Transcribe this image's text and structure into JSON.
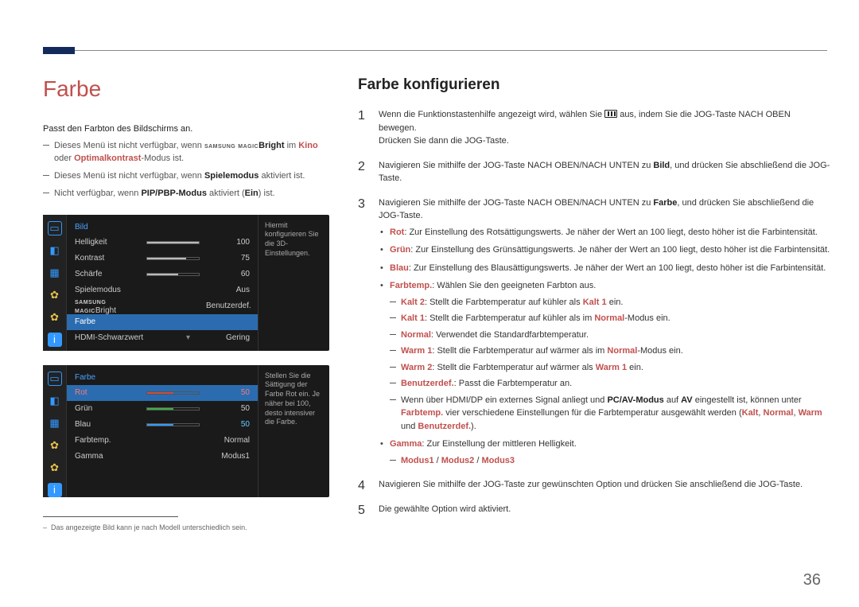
{
  "page_number": "36",
  "left": {
    "heading": "Farbe",
    "intro": "Passt den Farbton des Bildschirms an.",
    "note1_pre": "Dieses Menü ist nicht verfügbar, wenn ",
    "note1_magic_brand": "SAMSUNG",
    "note1_magic": "MAGIC",
    "note1_bright": "Bright",
    "note1_mid": " im ",
    "note1_kino": "Kino",
    "note1_or": " oder ",
    "note1_opt": "Optimalkontrast",
    "note1_suf": "-Modus ist.",
    "note2_pre": "Dieses Menü ist nicht verfügbar, wenn ",
    "note2_spiel": "Spielemodus",
    "note2_suf": " aktiviert ist.",
    "note3_pre": "Nicht verfügbar, wenn ",
    "note3_pip": "PIP/PBP-Modus",
    "note3_mid": " aktiviert (",
    "note3_ein": "Ein",
    "note3_suf": ") ist.",
    "footnote": "Das angezeigte Bild kann je nach Modell unterschiedlich sein."
  },
  "osd1": {
    "title": "Bild",
    "rows": {
      "helligkeit": {
        "label": "Helligkeit",
        "value": "100",
        "pct": 100
      },
      "kontrast": {
        "label": "Kontrast",
        "value": "75",
        "pct": 75
      },
      "schaerfe": {
        "label": "Schärfe",
        "value": "60",
        "pct": 60
      },
      "spielemodus": {
        "label": "Spielemodus",
        "value": "Aus"
      },
      "magicbright": {
        "label_brand": "SAMSUNG",
        "label_magic": "MAGIC",
        "label_suffix": "Bright",
        "value": "Benutzerdef."
      },
      "farbe": {
        "label": "Farbe"
      },
      "hdmi": {
        "label": "HDMI-Schwarzwert",
        "value": "Gering"
      }
    },
    "hint": "Hiermit konfigurieren Sie die 3D-Einstellungen."
  },
  "osd2": {
    "title": "Farbe",
    "rows": {
      "rot": {
        "label": "Rot",
        "value": "50",
        "pct": 50
      },
      "gruen": {
        "label": "Grün",
        "value": "50",
        "pct": 50
      },
      "blau": {
        "label": "Blau",
        "value": "50",
        "pct": 50
      },
      "farbtemp": {
        "label": "Farbtemp.",
        "value": "Normal"
      },
      "gamma": {
        "label": "Gamma",
        "value": "Modus1"
      }
    },
    "hint": "Stellen Sie die Sättigung der Farbe Rot ein. Je näher bei 100, desto intensiver die Farbe."
  },
  "right": {
    "heading": "Farbe konfigurieren",
    "step1a": "Wenn die Funktionstastenhilfe angezeigt wird, wählen Sie ",
    "step1b": " aus, indem Sie die JOG-Taste NACH OBEN bewegen.",
    "step1c": "Drücken Sie dann die JOG-Taste.",
    "step2a": "Navigieren Sie mithilfe der JOG-Taste NACH OBEN/NACH UNTEN zu ",
    "step2_bild": "Bild",
    "step2b": ", und drücken Sie abschließend die JOG-Taste.",
    "step3_farbe": "Farbe",
    "rot_lbl": "Rot",
    "rot_txt": ": Zur Einstellung des Rotsättigungswerts. Je näher der Wert an 100 liegt, desto höher ist die Farbintensität.",
    "gruen_lbl": "Grün",
    "gruen_txt": ": Zur Einstellung des Grünsättigungswerts. Je näher der Wert an 100 liegt, desto höher ist die Farbintensität.",
    "blau_lbl": "Blau",
    "blau_txt": ": Zur Einstellung des Blausättigungswerts. Je näher der Wert an 100 liegt, desto höher ist die Farbintensität.",
    "farbtemp_lbl": "Farbtemp.",
    "farbtemp_txt": ": Wählen Sie den geeigneten Farbton aus.",
    "kalt2_lbl": "Kalt 2",
    "kalt2_txt": ": Stellt die Farbtemperatur auf kühler als ",
    "kalt2_ref": "Kalt 1",
    "kalt2_suf": " ein.",
    "kalt1_lbl": "Kalt 1",
    "kalt1_txt": ": Stellt die Farbtemperatur auf kühler als im ",
    "kalt1_ref": "Normal",
    "kalt1_suf": "-Modus ein.",
    "normal_lbl": "Normal",
    "normal_txt": ": Verwendet die Standardfarbtemperatur.",
    "warm1_lbl": "Warm 1",
    "warm1_txt": ": Stellt die Farbtemperatur auf wärmer als im ",
    "warm1_ref": "Normal",
    "warm1_suf": "-Modus ein.",
    "warm2_lbl": "Warm 2",
    "warm2_txt": ": Stellt die Farbtemperatur auf wärmer als ",
    "warm2_ref": "Warm 1",
    "warm2_suf": " ein.",
    "benutz_lbl": "Benutzerdef.",
    "benutz_txt": ": Passt die Farbtemperatur an.",
    "hdmi_note_a": "Wenn über HDMI/DP ein externes Signal anliegt und ",
    "hdmi_note_pcav": "PC/AV-Modus",
    "hdmi_note_b": " auf ",
    "hdmi_note_av": "AV",
    "hdmi_note_c": " eingestellt ist, können unter ",
    "hdmi_note_farbtemp": "Farbtemp.",
    "hdmi_note_d": " vier verschiedene Einstellungen für die Farbtemperatur ausgewählt werden (",
    "hdmi_kalt": "Kalt",
    "hdmi_sep1": ", ",
    "hdmi_normal": "Normal",
    "hdmi_sep2": ", ",
    "hdmi_warm": "Warm",
    "hdmi_sep3": " und ",
    "hdmi_benutz": "Benutzerdef.",
    "hdmi_end": ").",
    "gamma_lbl": "Gamma",
    "gamma_txt": ": Zur Einstellung der mittleren Helligkeit.",
    "gamma_modes_1": "Modus1",
    "gamma_sep": " / ",
    "gamma_modes_2": "Modus2",
    "gamma_modes_3": "Modus3",
    "step4": "Navigieren Sie mithilfe der JOG-Taste zur gewünschten Option und drücken Sie anschließend die JOG-Taste.",
    "step5": "Die gewählte Option wird aktiviert."
  }
}
